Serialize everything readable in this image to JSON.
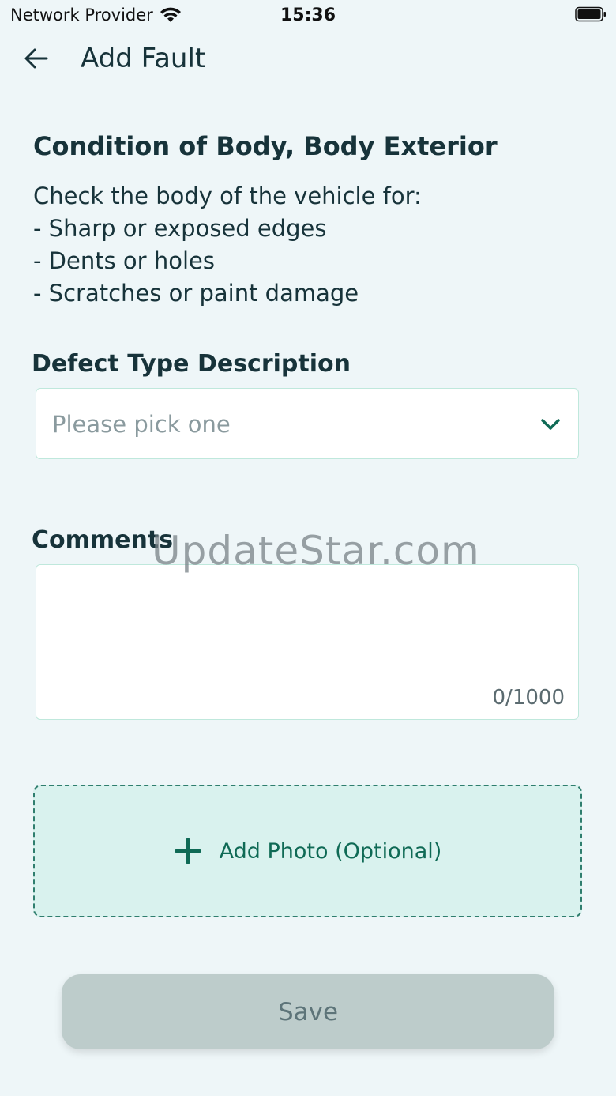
{
  "status_bar": {
    "carrier": "Network Provider",
    "time": "15:36"
  },
  "header": {
    "title": "Add Fault"
  },
  "inspection": {
    "title": "Condition of Body, Body Exterior",
    "instructions": [
      "Check the body of the vehicle for:",
      "- Sharp or exposed edges",
      "- Dents or holes",
      "- Scratches or paint damage"
    ]
  },
  "defect_type": {
    "label": "Defect Type Description",
    "placeholder": "Please pick one"
  },
  "comments": {
    "label": "Comments",
    "counter": "0/1000"
  },
  "photo": {
    "label": "Add Photo (Optional)"
  },
  "save": {
    "label": "Save"
  },
  "watermark": "UpdateStar.com",
  "colors": {
    "background": "#eef6f8",
    "accent": "#0f6a55",
    "photo_bg": "#d9f2ee",
    "save_disabled": "#bdcccb"
  }
}
